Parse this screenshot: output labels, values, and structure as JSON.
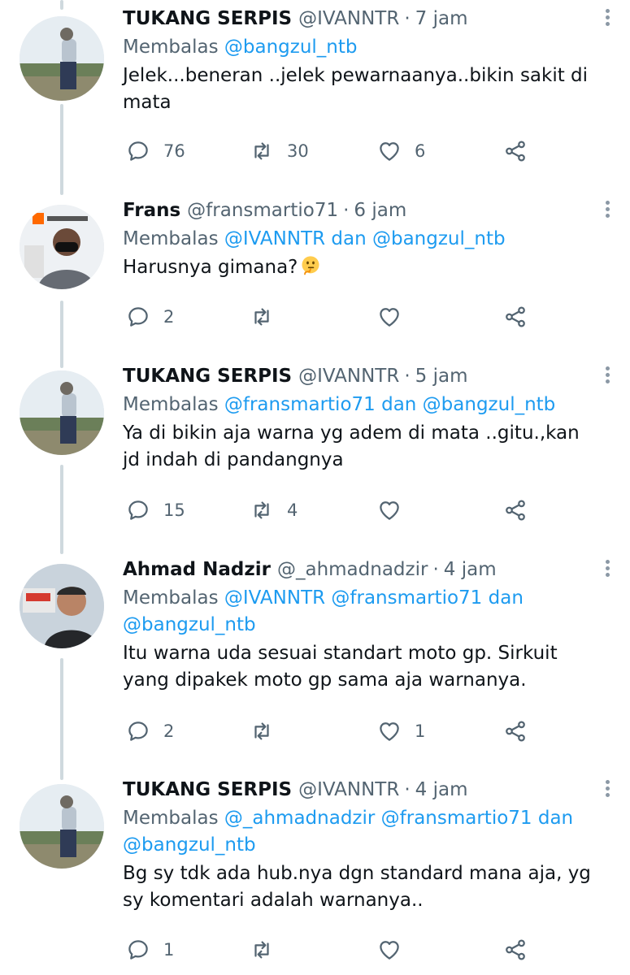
{
  "tweets": [
    {
      "name": "TUKANG SERPIS",
      "handle": "@IVANNTR",
      "time": "7 jam",
      "reply_prefix": "Membalas",
      "reply_mentions": "@bangzul_ntb",
      "text": "Jelek...beneran ..jelek pewarnaanya..bikin sakit di mata",
      "replies": "76",
      "retweets": "30",
      "likes": "6"
    },
    {
      "name": "Frans",
      "handle": "@fransmartio71",
      "time": "6 jam",
      "reply_prefix": "Membalas",
      "reply_mentions": "@IVANNTR dan @bangzul_ntb",
      "text": "Harusnya gimana?",
      "emoji": "thinking-face",
      "replies": "2",
      "retweets": "",
      "likes": ""
    },
    {
      "name": "TUKANG SERPIS",
      "handle": "@IVANNTR",
      "time": "5 jam",
      "reply_prefix": "Membalas",
      "reply_mentions": "@fransmartio71 dan @bangzul_ntb",
      "text": "Ya di bikin aja warna yg adem di mata ..gitu.,kan jd indah di pandangnya",
      "replies": "15",
      "retweets": "4",
      "likes": ""
    },
    {
      "name": "Ahmad Nadzir",
      "handle": "@_ahmadnadzir",
      "time": "4 jam",
      "reply_prefix": "Membalas",
      "reply_mentions": "@IVANNTR @fransmartio71 dan @bangzul_ntb",
      "text": "Itu warna uda sesuai standart moto gp. Sirkuit   yang dipakek moto gp sama aja warnanya.",
      "replies": "2",
      "retweets": "",
      "likes": "1"
    },
    {
      "name": "TUKANG SERPIS",
      "handle": "@IVANNTR",
      "time": "4 jam",
      "reply_prefix": "Membalas",
      "reply_mentions": "@_ahmadnadzir @fransmartio71 dan @bangzul_ntb",
      "text": "Bg sy tdk ada hub.nya dgn standard mana aja, yg sy komentari adalah warnanya..",
      "replies": "1",
      "retweets": "",
      "likes": ""
    }
  ],
  "separator": "·",
  "icons": {
    "reply": "speech-bubble-icon",
    "retweet": "retweet-icon",
    "like": "heart-icon",
    "share": "share-icon",
    "more": "more-vertical-icon"
  },
  "colors": {
    "accent": "#1d9bf0",
    "secondary_text": "#536471",
    "thread_line": "#cfd9de"
  }
}
